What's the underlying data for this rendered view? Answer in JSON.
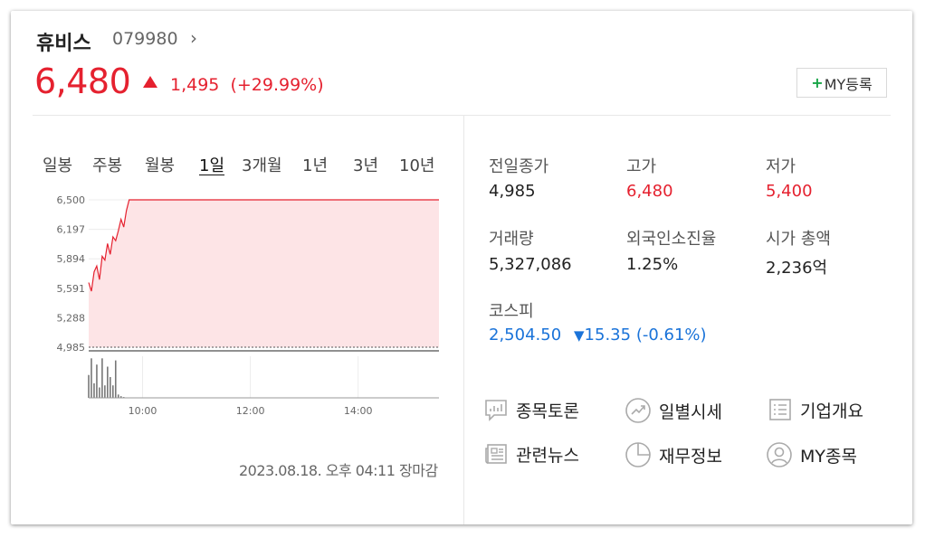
{
  "stock": {
    "name": "휴비스",
    "code": "079980",
    "price": "6,480",
    "change": "1,495",
    "change_pct": "(+29.99%)",
    "colors": {
      "up": "#e5212f",
      "down": "#1a73d9"
    }
  },
  "my_button": {
    "plus": "+",
    "label": "MY등록"
  },
  "tabs": [
    "일봉",
    "주봉",
    "월봉",
    "1일",
    "3개월",
    "1년",
    "3년",
    "10년"
  ],
  "active_tab": "1일",
  "chart_data": {
    "type": "area",
    "y_ticks": [
      "6,500",
      "6,197",
      "5,894",
      "5,591",
      "5,288",
      "4,985"
    ],
    "x_ticks": [
      "10:00",
      "12:00",
      "14:00"
    ],
    "ylim": [
      4985,
      6500
    ],
    "xlim": [
      "09:00",
      "15:30"
    ],
    "baseline": 4985,
    "series": [
      {
        "x": [
          "09:00",
          "09:03",
          "09:06",
          "09:09",
          "09:12",
          "09:15",
          "09:18",
          "09:21",
          "09:24",
          "09:27",
          "09:30",
          "09:33",
          "09:36",
          "09:39",
          "09:42",
          "09:45",
          "10:00",
          "12:00",
          "14:00",
          "15:30"
        ],
        "y": [
          5650,
          5560,
          5760,
          5820,
          5680,
          5920,
          5880,
          6050,
          5940,
          6120,
          6080,
          6180,
          6300,
          6220,
          6390,
          6500,
          6500,
          6500,
          6500,
          6500
        ]
      }
    ],
    "volume": {
      "x": [
        "09:00",
        "09:03",
        "09:06",
        "09:09",
        "09:12",
        "09:15",
        "09:18",
        "09:21",
        "09:24",
        "09:27",
        "09:30",
        "09:33",
        "09:36",
        "09:39"
      ],
      "values": [
        0.55,
        0.95,
        0.35,
        0.8,
        0.25,
        0.95,
        0.3,
        0.75,
        0.5,
        0.3,
        0.9,
        0.08,
        0.04,
        0.02
      ]
    },
    "fill_color": "#fde4e6",
    "line_color": "#e5212f"
  },
  "timestamp": "2023.08.18. 오후 04:11 장마감",
  "info": [
    {
      "label": "전일종가",
      "value": "4,985",
      "color": "normal"
    },
    {
      "label": "고가",
      "value": "6,480",
      "color": "red"
    },
    {
      "label": "저가",
      "value": "5,400",
      "color": "red"
    },
    {
      "label": "거래량",
      "value": "5,327,086",
      "color": "normal"
    },
    {
      "label": "외국인소진율",
      "value": "1.25%",
      "color": "normal"
    },
    {
      "label": "시가 총액",
      "value": "2,236억",
      "color": "normal"
    }
  ],
  "kospi": {
    "label": "코스피",
    "value": "2,504.50",
    "change": "15.35",
    "change_pct": "(-0.61%)"
  },
  "links": [
    {
      "label": "종목토론",
      "icon": "discussion-chart-icon"
    },
    {
      "label": "일별시세",
      "icon": "trend-circle-icon"
    },
    {
      "label": "기업개요",
      "icon": "company-list-icon"
    },
    {
      "label": "관련뉴스",
      "icon": "news-icon"
    },
    {
      "label": "재무정보",
      "icon": "pie-chart-icon"
    },
    {
      "label": "MY종목",
      "icon": "user-icon"
    }
  ]
}
